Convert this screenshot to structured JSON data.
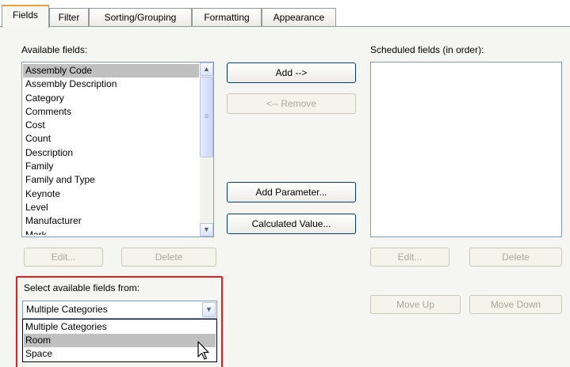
{
  "tabs": [
    {
      "label": "Fields",
      "active": true
    },
    {
      "label": "Filter",
      "active": false
    },
    {
      "label": "Sorting/Grouping",
      "active": false
    },
    {
      "label": "Formatting",
      "active": false
    },
    {
      "label": "Appearance",
      "active": false
    }
  ],
  "available": {
    "label": "Available fields:",
    "items": [
      "Assembly Code",
      "Assembly Description",
      "Category",
      "Comments",
      "Cost",
      "Count",
      "Description",
      "Family",
      "Family and Type",
      "Keynote",
      "Level",
      "Manufacturer",
      "Mark"
    ],
    "selected_index": 0,
    "edit_label": "Edit...",
    "delete_label": "Delete"
  },
  "middle": {
    "add_label": "Add -->",
    "remove_label": "<-- Remove",
    "add_parameter_label": "Add Parameter...",
    "calculated_value_label": "Calculated Value..."
  },
  "scheduled": {
    "label": "Scheduled fields (in order):",
    "items": [],
    "edit_label": "Edit...",
    "delete_label": "Delete",
    "move_up_label": "Move Up",
    "move_down_label": "Move Down"
  },
  "source": {
    "label": "Select available fields from:",
    "selected": "Multiple Categories",
    "options": [
      "Multiple Categories",
      "Room",
      "Space"
    ],
    "hover_index": 1,
    "highlight_color": "#e02020"
  },
  "icons": {
    "scroll_up": "▲",
    "scroll_down": "▼",
    "grip": "≡",
    "dropdown_arrow": "▼"
  }
}
